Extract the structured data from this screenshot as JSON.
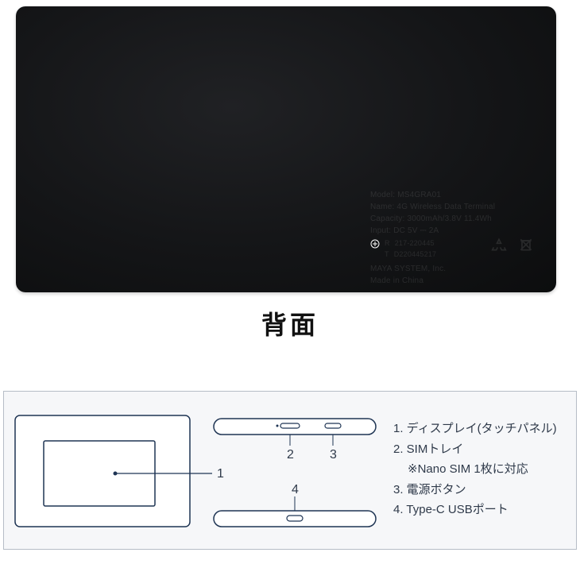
{
  "caption": "背面",
  "device_label": {
    "model_line": "Model: MS4GRA01",
    "name_line": "Name: 4G Wireless Data Terminal",
    "capacity_line": "Capacity: 3000mAh/3.8V 11.4Wh",
    "input_line": "Input: DC 5V ⎓ 2A",
    "cert_a": "217-220445",
    "cert_b": "D220445217",
    "company": "MAYA SYSTEM, Inc.",
    "made_in": "Made in China"
  },
  "diagram": {
    "marker_1": "1",
    "marker_2": "2",
    "marker_3": "3",
    "marker_4": "4"
  },
  "legend": {
    "item1": "1. ディスプレイ(タッチパネル)",
    "item2": "2. SIMトレイ",
    "item2_note": "※Nano SIM 1枚に対応",
    "item3": "3. 電源ボタン",
    "item4": "4. Type-C USBポート"
  }
}
